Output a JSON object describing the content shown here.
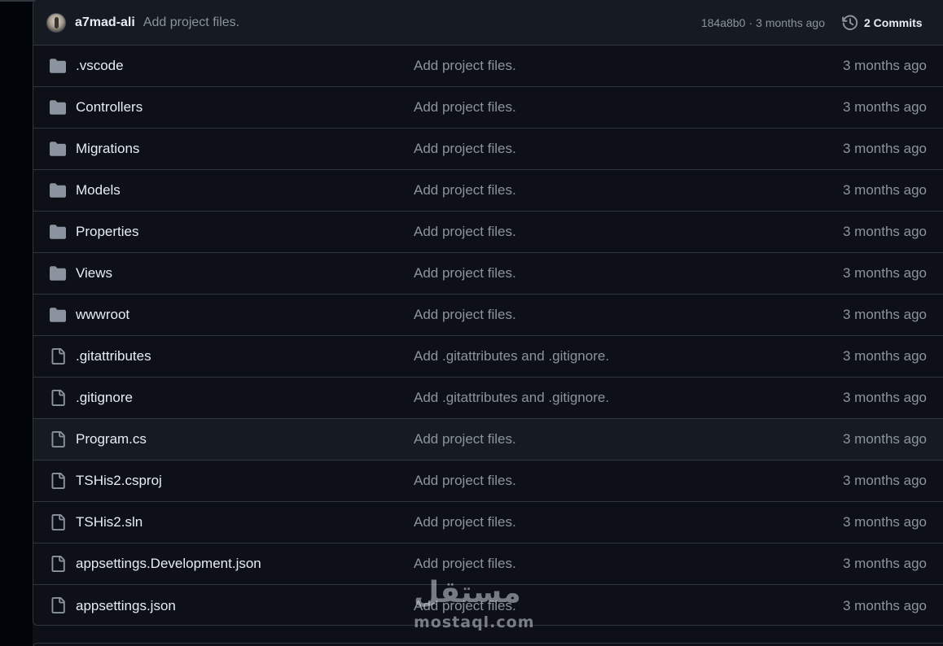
{
  "latest_commit": {
    "author": "a7mad-ali",
    "message": "Add project files.",
    "sha": "184a8b0",
    "separator": "·",
    "time": "3 months ago",
    "commits_label": "2 Commits"
  },
  "files": [
    {
      "type": "folder",
      "name": ".vscode",
      "message": "Add project files.",
      "age": "3 months ago"
    },
    {
      "type": "folder",
      "name": "Controllers",
      "message": "Add project files.",
      "age": "3 months ago"
    },
    {
      "type": "folder",
      "name": "Migrations",
      "message": "Add project files.",
      "age": "3 months ago"
    },
    {
      "type": "folder",
      "name": "Models",
      "message": "Add project files.",
      "age": "3 months ago"
    },
    {
      "type": "folder",
      "name": "Properties",
      "message": "Add project files.",
      "age": "3 months ago"
    },
    {
      "type": "folder",
      "name": "Views",
      "message": "Add project files.",
      "age": "3 months ago"
    },
    {
      "type": "folder",
      "name": "wwwroot",
      "message": "Add project files.",
      "age": "3 months ago"
    },
    {
      "type": "file",
      "name": ".gitattributes",
      "message": "Add .gitattributes and .gitignore.",
      "age": "3 months ago"
    },
    {
      "type": "file",
      "name": ".gitignore",
      "message": "Add .gitattributes and .gitignore.",
      "age": "3 months ago"
    },
    {
      "type": "file",
      "name": "Program.cs",
      "message": "Add project files.",
      "age": "3 months ago",
      "highlighted": true
    },
    {
      "type": "file",
      "name": "TSHis2.csproj",
      "message": "Add project files.",
      "age": "3 months ago"
    },
    {
      "type": "file",
      "name": "TSHis2.sln",
      "message": "Add project files.",
      "age": "3 months ago"
    },
    {
      "type": "file",
      "name": "appsettings.Development.json",
      "message": "Add project files.",
      "age": "3 months ago"
    },
    {
      "type": "file",
      "name": "appsettings.json",
      "message": "Add project files.",
      "age": "3 months ago"
    }
  ],
  "watermark": {
    "arabic": "مستقل",
    "latin": "mostaql.com"
  },
  "colors": {
    "background": "#0d1117",
    "header_background": "#161b22",
    "border": "#30363d",
    "text_primary": "#e6edf3",
    "text_muted": "#8b949e",
    "icon": "#8b949e"
  },
  "icons": {
    "folder": "folder-icon",
    "file": "file-icon",
    "history": "history-icon"
  }
}
